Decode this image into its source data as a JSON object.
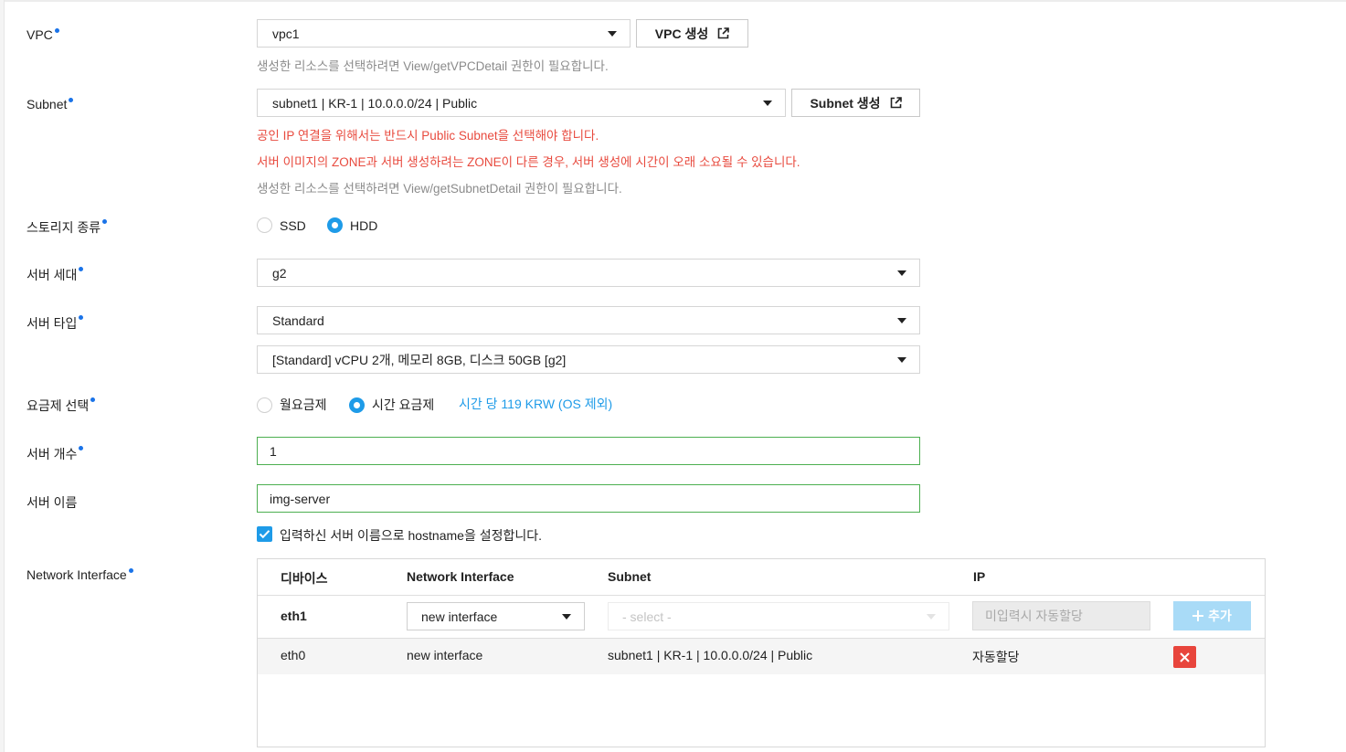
{
  "vpc": {
    "label": "VPC",
    "value": "vpc1",
    "create_button": "VPC 생성",
    "help": "생성한 리소스를 선택하려면 View/getVPCDetail 권한이 필요합니다."
  },
  "subnet": {
    "label": "Subnet",
    "value": "subnet1 | KR-1 | 10.0.0.0/24 | Public",
    "create_button": "Subnet 생성",
    "warning1": "공인 IP 연결을 위해서는 반드시 Public Subnet을 선택해야 합니다.",
    "warning2": "서버 이미지의 ZONE과 서버 생성하려는 ZONE이 다른 경우, 서버 생성에 시간이 오래 소요될 수 있습니다.",
    "help": "생성한 리소스를 선택하려면 View/getSubnetDetail 권한이 필요합니다."
  },
  "storage": {
    "label": "스토리지 종류",
    "options": [
      "SSD",
      "HDD"
    ],
    "selected": "HDD"
  },
  "generation": {
    "label": "서버 세대",
    "value": "g2"
  },
  "server_type": {
    "label": "서버 타입",
    "type_value": "Standard",
    "spec_value": "[Standard] vCPU 2개, 메모리 8GB, 디스크 50GB [g2]"
  },
  "billing": {
    "label": "요금제 선택",
    "options": [
      "월요금제",
      "시간 요금제"
    ],
    "selected": "시간 요금제",
    "price": "시간 당 119 KRW (OS 제외)"
  },
  "count": {
    "label": "서버 개수",
    "value": "1"
  },
  "name": {
    "label": "서버 이름",
    "value": "img-server",
    "hostname_checkbox_label": "입력하신 서버 이름으로 hostname을 설정합니다.",
    "hostname_checked": true
  },
  "network_interface": {
    "label": "Network Interface",
    "headers": [
      "디바이스",
      "Network Interface",
      "Subnet",
      "IP"
    ],
    "new_row": {
      "device": "eth1",
      "interface": "new interface",
      "subnet_placeholder": "- select -",
      "ip_placeholder": "미입력시 자동할당",
      "add_button": "추가"
    },
    "rows": [
      {
        "device": "eth0",
        "interface": "new interface",
        "subnet": "subnet1 | KR-1 | 10.0.0.0/24 | Public",
        "ip": "자동할당"
      }
    ]
  },
  "colors": {
    "accent": "#1e9be8",
    "required_dot": "#1a73e8",
    "warning": "#e84a3e",
    "valid_border": "#4caf50",
    "delete": "#e8453c"
  }
}
